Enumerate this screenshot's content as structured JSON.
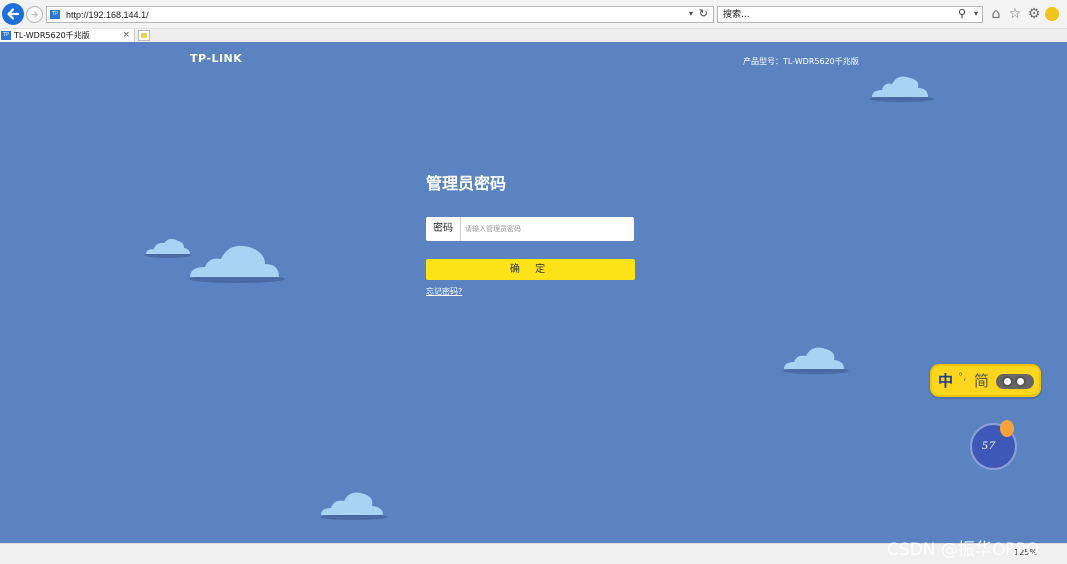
{
  "browser": {
    "url": "http://192.168.144.1/",
    "search_text": "搜索...",
    "tab_title": "TL-WDR5620千兆版",
    "tab_close": "×",
    "zoom": "125%"
  },
  "page": {
    "brand": "TP-LINK",
    "model": "产品型号：TL-WDR5620千兆版",
    "title": "管理员密码",
    "password_label": "密码",
    "password_placeholder": "请输入管理员密码",
    "confirm_label": "确 定",
    "forgot_label": "忘记密码?",
    "background_color": "#5b83c1",
    "button_color": "#fbe318"
  },
  "ime": {
    "zh": "中",
    "dots": "°,",
    "jian": "简"
  },
  "speed_ball": {
    "value": "57"
  },
  "watermark": "CSDN @振华OPPO"
}
